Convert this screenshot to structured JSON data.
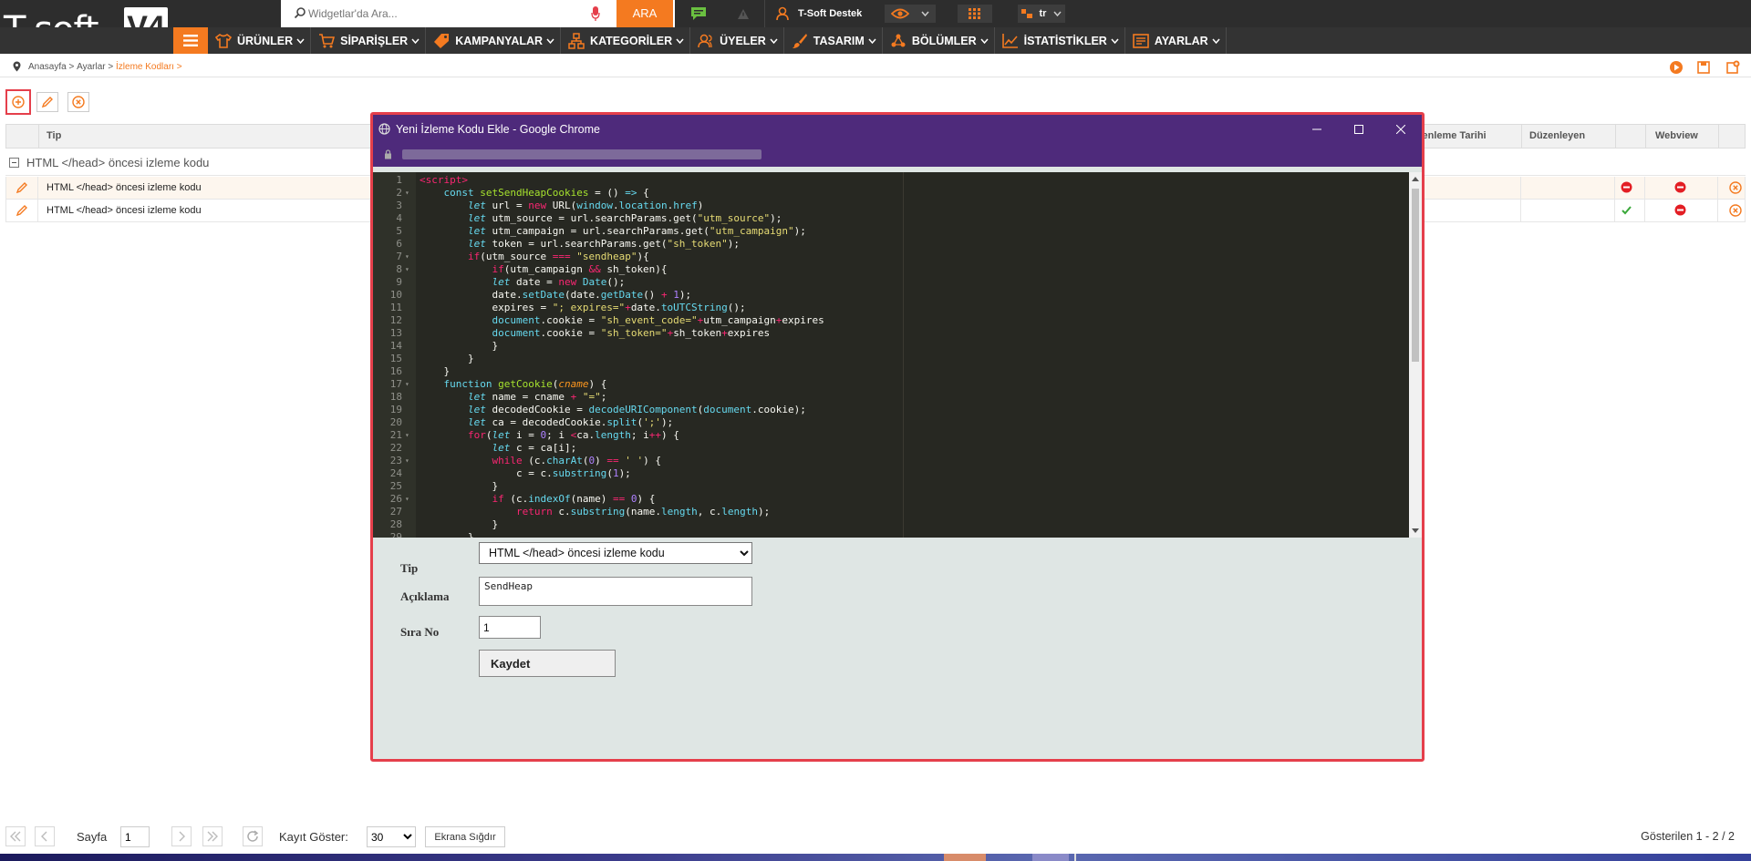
{
  "logo": {
    "brand": "T-soft",
    "version": "V4"
  },
  "search": {
    "placeholder": "Widgetlar'da Ara...",
    "button": "ARA"
  },
  "support": {
    "label": "T-Soft Destek"
  },
  "lang": {
    "value": "tr"
  },
  "nav": {
    "items": [
      {
        "label": "ÜRÜNLER",
        "icon": "shirt-icon"
      },
      {
        "label": "SİPARİŞLER",
        "icon": "cart-icon"
      },
      {
        "label": "KAMPANYALAR",
        "icon": "tag-icon"
      },
      {
        "label": "KATEGORİLER",
        "icon": "sitemap-icon"
      },
      {
        "label": "ÜYELER",
        "icon": "users-icon"
      },
      {
        "label": "TASARIM",
        "icon": "brush-icon"
      },
      {
        "label": "BÖLÜMLER",
        "icon": "sections-icon"
      },
      {
        "label": "İSTATİSTİKLER",
        "icon": "chart-icon"
      },
      {
        "label": "AYARLAR",
        "icon": "settings-icon"
      }
    ]
  },
  "breadcrumb": {
    "home": "Anasayfa",
    "sep": " > ",
    "settings": "Ayarlar",
    "current": "İzleme Kodları >"
  },
  "grid": {
    "headers": {
      "tip": "Tip",
      "date": "zenleme Tarihi",
      "editor": "Düzenleyen",
      "webview": "Webview"
    },
    "group_label": "HTML </head> öncesi izleme kodu",
    "rows": [
      {
        "tip": "HTML </head> öncesi izleme kodu"
      },
      {
        "tip": "HTML </head> öncesi izleme kodu"
      }
    ]
  },
  "modal": {
    "title": "Yeni İzleme Kodu Ekle - Google Chrome",
    "form": {
      "tip_label": "Tip",
      "tip_value": "HTML </head> öncesi izleme kodu",
      "desc_label": "Açıklama",
      "desc_value": "SendHeap",
      "order_label": "Sıra No",
      "order_value": "1",
      "save_label": "Kaydet"
    },
    "code": [
      {
        "n": "1",
        "fold": false,
        "html": "<span style='color:#f92672'>&lt;script&gt;</span>"
      },
      {
        "n": "2",
        "fold": true,
        "html": "    <span style='color:#66d9ef'>const</span> <span style='color:#a6e22e'>setSendHeapCookies</span> = () <span style='color:#66d9ef'>=&gt;</span> {"
      },
      {
        "n": "3",
        "fold": false,
        "html": "        <span style='color:#66d9ef;font-style:italic'>let</span> url = <span style='color:#f92672'>new</span> URL(<span style='color:#66d9ef'>window</span>.<span style='color:#66d9ef'>location</span>.<span style='color:#66d9ef'>href</span>)"
      },
      {
        "n": "4",
        "fold": false,
        "html": "        <span style='color:#66d9ef;font-style:italic'>let</span> utm_source = url.searchParams.get(<span style='color:#e6db74'>\"utm_source\"</span>);"
      },
      {
        "n": "5",
        "fold": false,
        "html": "        <span style='color:#66d9ef;font-style:italic'>let</span> utm_campaign = url.searchParams.get(<span style='color:#e6db74'>\"utm_campaign\"</span>);"
      },
      {
        "n": "6",
        "fold": false,
        "html": "        <span style='color:#66d9ef;font-style:italic'>let</span> token = url.searchParams.get(<span style='color:#e6db74'>\"sh_token\"</span>);"
      },
      {
        "n": "7",
        "fold": true,
        "html": "        <span style='color:#f92672'>if</span>(utm_source <span style='color:#f92672'>===</span> <span style='color:#e6db74'>\"sendheap\"</span>){"
      },
      {
        "n": "8",
        "fold": true,
        "html": "            <span style='color:#f92672'>if</span>(utm_campaign <span style='color:#f92672'>&amp;&amp;</span> sh_token){"
      },
      {
        "n": "9",
        "fold": false,
        "html": "            <span style='color:#66d9ef;font-style:italic'>let</span> date = <span style='color:#f92672'>new</span> <span style='color:#66d9ef'>Date</span>();"
      },
      {
        "n": "10",
        "fold": false,
        "html": "            date.<span style='color:#66d9ef'>setDate</span>(date.<span style='color:#66d9ef'>getDate</span>() <span style='color:#f92672'>+</span> <span style='color:#ae81ff'>1</span>);"
      },
      {
        "n": "11",
        "fold": false,
        "html": "            expires = <span style='color:#e6db74'>\"; expires=\"</span><span style='color:#f92672'>+</span>date.<span style='color:#66d9ef'>toUTCString</span>();"
      },
      {
        "n": "12",
        "fold": false,
        "html": "            <span style='color:#66d9ef'>document</span>.cookie = <span style='color:#e6db74'>\"sh_event_code=\"</span><span style='color:#f92672'>+</span>utm_campaign<span style='color:#f92672'>+</span>expires"
      },
      {
        "n": "13",
        "fold": false,
        "html": "            <span style='color:#66d9ef'>document</span>.cookie = <span style='color:#e6db74'>\"sh_token=\"</span><span style='color:#f92672'>+</span>sh_token<span style='color:#f92672'>+</span>expires"
      },
      {
        "n": "14",
        "fold": false,
        "html": "            }"
      },
      {
        "n": "15",
        "fold": false,
        "html": "        }"
      },
      {
        "n": "16",
        "fold": false,
        "html": "    }"
      },
      {
        "n": "17",
        "fold": true,
        "html": "    <span style='color:#66d9ef'>function</span> <span style='color:#a6e22e'>getCookie</span>(<span style='color:#fd971f;font-style:italic'>cname</span>) {"
      },
      {
        "n": "18",
        "fold": false,
        "html": "        <span style='color:#66d9ef;font-style:italic'>let</span> name = cname <span style='color:#f92672'>+</span> <span style='color:#e6db74'>\"=\"</span>;"
      },
      {
        "n": "19",
        "fold": false,
        "html": "        <span style='color:#66d9ef;font-style:italic'>let</span> decodedCookie = <span style='color:#66d9ef'>decodeURIComponent</span>(<span style='color:#66d9ef'>document</span>.cookie);"
      },
      {
        "n": "20",
        "fold": false,
        "html": "        <span style='color:#66d9ef;font-style:italic'>let</span> ca = decodedCookie.<span style='color:#66d9ef'>split</span>(<span style='color:#e6db74'>';'</span>);"
      },
      {
        "n": "21",
        "fold": true,
        "html": "        <span style='color:#f92672'>for</span>(<span style='color:#66d9ef;font-style:italic'>let</span> i = <span style='color:#ae81ff'>0</span>; i <span style='color:#f92672'>&lt;</span>ca.<span style='color:#66d9ef'>length</span>; i<span style='color:#f92672'>++</span>) {"
      },
      {
        "n": "22",
        "fold": false,
        "html": "            <span style='color:#66d9ef;font-style:italic'>let</span> c = ca[i];"
      },
      {
        "n": "23",
        "fold": true,
        "html": "            <span style='color:#f92672'>while</span> (c.<span style='color:#66d9ef'>charAt</span>(<span style='color:#ae81ff'>0</span>) <span style='color:#f92672'>==</span> <span style='color:#e6db74'>' '</span>) {"
      },
      {
        "n": "24",
        "fold": false,
        "html": "                c = c.<span style='color:#66d9ef'>substring</span>(<span style='color:#ae81ff'>1</span>);"
      },
      {
        "n": "25",
        "fold": false,
        "html": "            }"
      },
      {
        "n": "26",
        "fold": true,
        "html": "            <span style='color:#f92672'>if</span> (c.<span style='color:#66d9ef'>indexOf</span>(name) <span style='color:#f92672'>==</span> <span style='color:#ae81ff'>0</span>) {"
      },
      {
        "n": "27",
        "fold": false,
        "html": "                <span style='color:#f92672'>return</span> c.<span style='color:#66d9ef'>substring</span>(name.<span style='color:#66d9ef'>length</span>, c.<span style='color:#66d9ef'>length</span>);"
      },
      {
        "n": "28",
        "fold": false,
        "html": "            }"
      },
      {
        "n": "29",
        "fold": false,
        "html": "        }"
      }
    ]
  },
  "pager": {
    "page_label": "Sayfa",
    "page_value": "1",
    "size_label": "Kayıt Göster:",
    "size_value": "30",
    "fit_label": "Ekrana Sığdır",
    "shown": "Gösterilen 1 - 2 / 2"
  },
  "colors": {
    "accent": "#f47a20",
    "topbar": "#2d2d2d",
    "modal_title": "#4e2a7b",
    "highlight": "#e53f4b"
  }
}
